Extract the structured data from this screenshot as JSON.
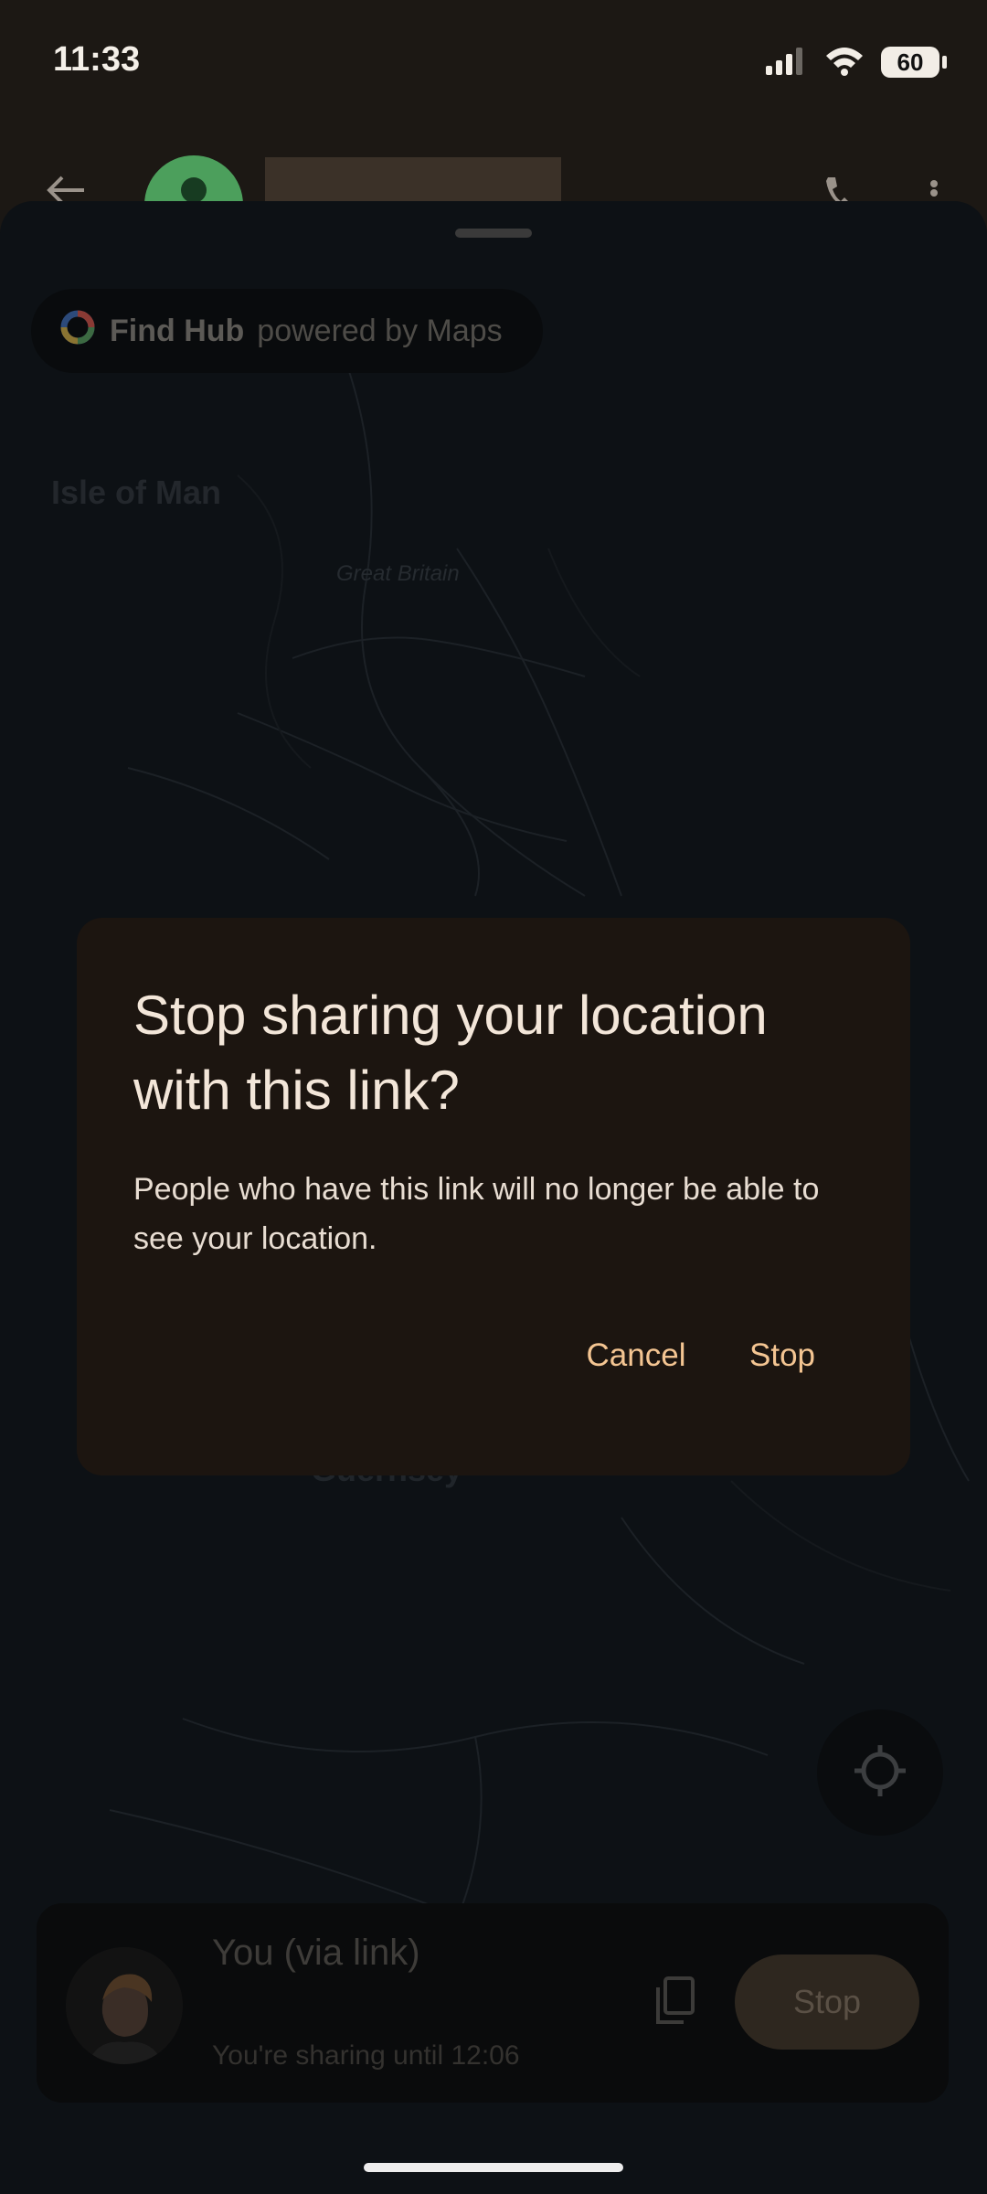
{
  "status_bar": {
    "time": "11:33",
    "battery": "60"
  },
  "chip": {
    "brand": "Find Hub",
    "tagline": "powered by Maps"
  },
  "map_labels": {
    "isle_of_man": "Isle of Man",
    "great_britain": "Great Britain",
    "guernsey": "Guernsey"
  },
  "dialog": {
    "title": "Stop sharing your location with this link?",
    "body": "People who have this link will no longer be able to see your location.",
    "cancel_label": "Cancel",
    "stop_label": "Stop"
  },
  "share_card": {
    "name": "You (via link)",
    "until": "You're sharing until 12:06",
    "stop_label": "Stop"
  },
  "colors": {
    "scrim": "#0d1115",
    "dialog_bg": "#1c1510",
    "accent": "#f4c592"
  }
}
